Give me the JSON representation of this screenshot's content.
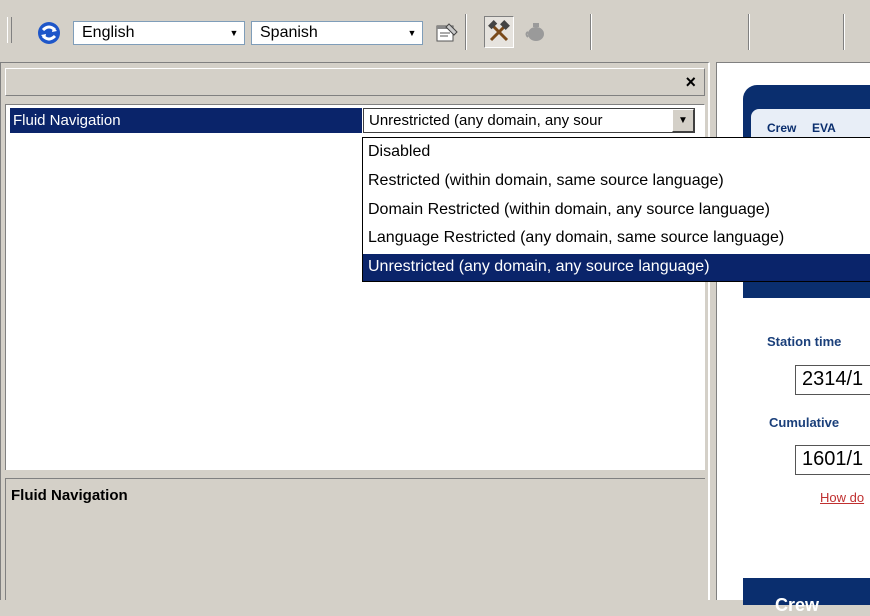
{
  "toolbar": {
    "source_language": "English",
    "target_language": "Spanish",
    "icons": [
      "sync-icon",
      "properties-icon",
      "tools-icon",
      "pot-icon"
    ]
  },
  "panel": {
    "close_glyph": "×",
    "property_name": "Fluid Navigation",
    "property_value": "Unrestricted (any domain, any sour",
    "options": [
      "Disabled",
      "Restricted (within domain, same source language)",
      "Domain Restricted (within domain, any source language)",
      "Language Restricted (any domain, same source language)",
      "Unrestricted (any domain, any source language)"
    ],
    "selected_index": 4,
    "description_title": "Fluid Navigation"
  },
  "web": {
    "tab1": "Crew",
    "tab2": "EVA",
    "station_time_label": "Station time",
    "station_time_value": "2314/1",
    "cumulative_label": "Cumulative",
    "cumulative_value": "1601/1",
    "link": "How do",
    "footer": "Crew"
  },
  "colors": {
    "selection": "#0a246a",
    "web_navy": "#0a2e6e",
    "sync_icon": "#1e56c9"
  }
}
